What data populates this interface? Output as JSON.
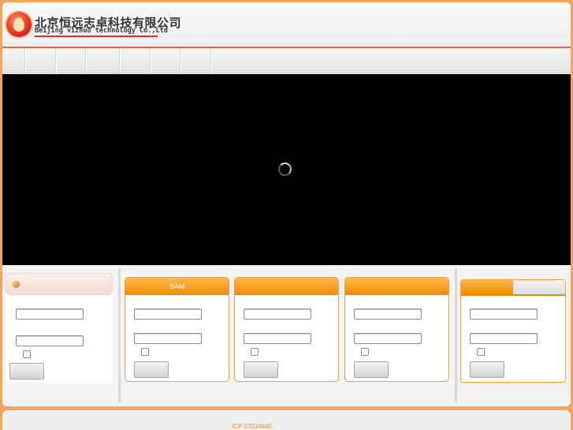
{
  "header": {
    "company_cn": "北京恒远志卓科技有限公司",
    "company_en": "Beijing vizhuo technology Co.,Ltd"
  },
  "nav": {
    "items": [
      "",
      "",
      "",
      "",
      "",
      "",
      ""
    ]
  },
  "video": {
    "state": "loading"
  },
  "login_panels": {
    "sam_title": "SAM"
  },
  "footer": {
    "icp": "ICP 07034645"
  },
  "colors": {
    "accent_orange": "#f28a05",
    "page_background": "#f7a35c",
    "footer_text": "#e88a3c"
  }
}
